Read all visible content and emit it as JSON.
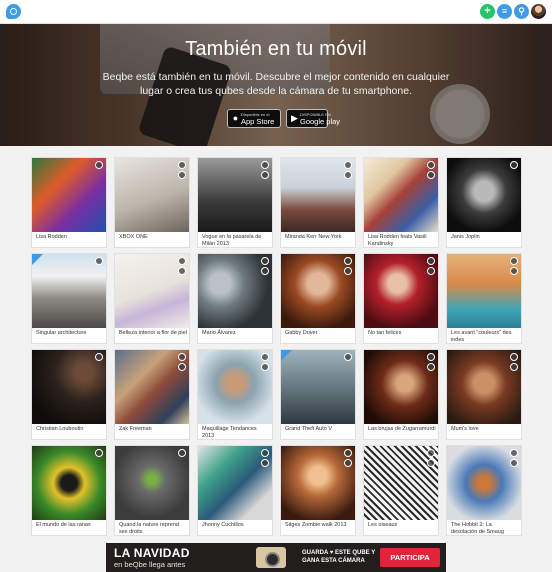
{
  "topbar": {
    "logo_icon": "qubes-logo-icon",
    "add_icon": "plus-icon",
    "add_glyph": "+",
    "menu_icon": "list-icon",
    "menu_glyph": "≡",
    "search_icon": "search-icon",
    "search_glyph": "⚲",
    "avatar_icon": "user-avatar"
  },
  "hero": {
    "title": "También en tu móvil",
    "subtitle": "Beqbe está también en tu móvil. Descubre el mejor contenido en cualquier lugar o crea tus qubes desde la cámara de tu smartphone.",
    "app_store_small": "Disponible en el",
    "app_store_label": "App Store",
    "google_play_small": "DISPONIBLE EN",
    "google_play_label": "Google play"
  },
  "cards": [
    {
      "caption": "Lisa Rodden"
    },
    {
      "caption": "XBOX ONE"
    },
    {
      "caption": "Vogue en la pasarela de Milán 2013"
    },
    {
      "caption": "Miranda Kerr New York"
    },
    {
      "caption": "Lisa Rodden feats Vasili Kandinsky"
    },
    {
      "caption": "Janis Joplin"
    },
    {
      "caption": "Singular architecture"
    },
    {
      "caption": "Belleza interior a flor de piel"
    },
    {
      "caption": "Mario Álvarez"
    },
    {
      "caption": "Gabby Dover"
    },
    {
      "caption": "No tan felices"
    },
    {
      "caption": "Les avant \"couleurs\" des indes"
    },
    {
      "caption": "Christian Louboutin"
    },
    {
      "caption": "Zak Freeman"
    },
    {
      "caption": "Maquillage Tendances 2013"
    },
    {
      "caption": "Grand Theft Auto V"
    },
    {
      "caption": "Las brujas de Zugarramurdi"
    },
    {
      "caption": "Mum's love"
    },
    {
      "caption": "El mundo de las ranas"
    },
    {
      "caption": "Quand la nature reprend ses droits"
    },
    {
      "caption": "Jhonny Cuchillos"
    },
    {
      "caption": "Sitges Zombie walk 2013"
    },
    {
      "caption": "Les oiseaux"
    },
    {
      "caption": "The Hobbit 2: La desolación de Smaug"
    }
  ],
  "banner": {
    "headline": "LA NAVIDAD",
    "subline": "en beQbe llega antes",
    "promo": "GUARDA ♥ ESTE QUBE Y GANA ESTA CÁMARA",
    "cta": "PARTICIPA"
  }
}
